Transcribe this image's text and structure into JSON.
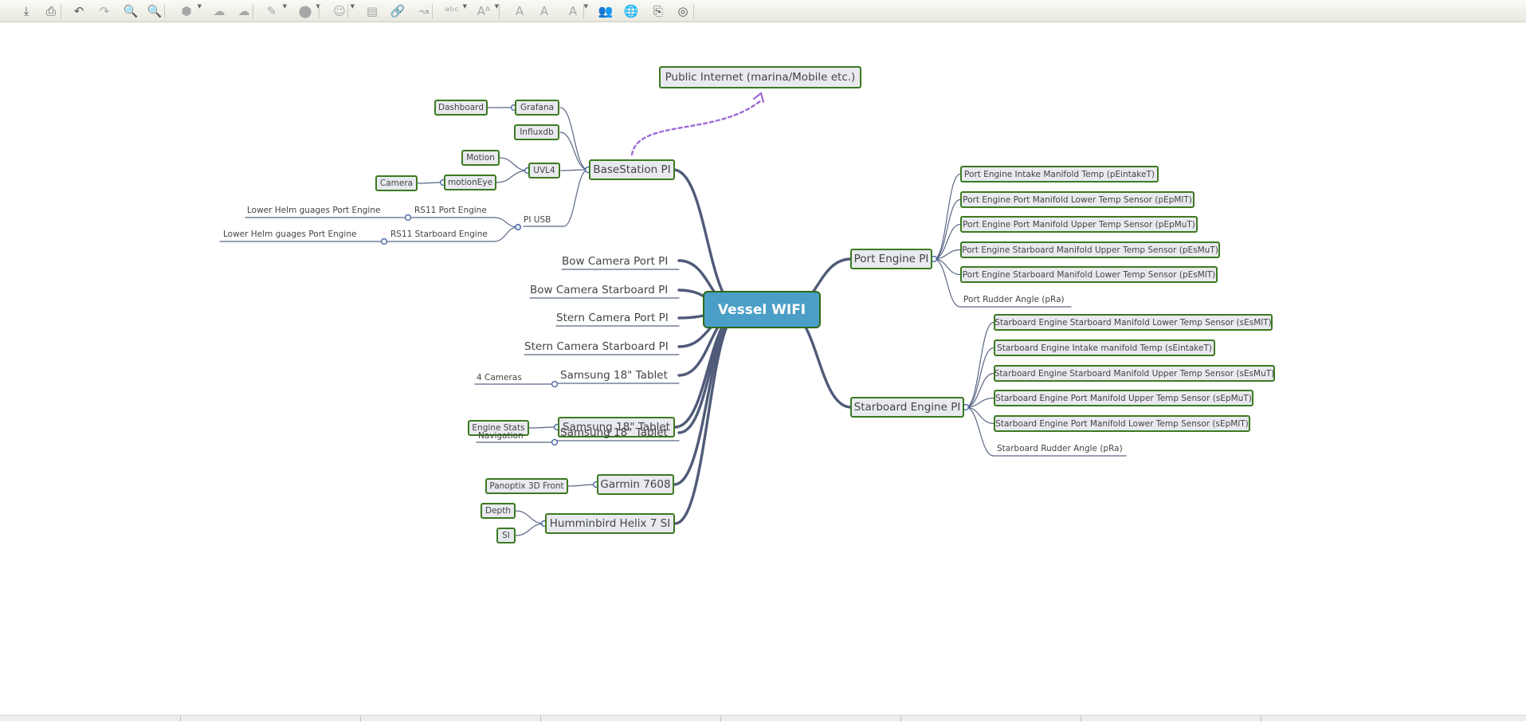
{
  "toolbar": {
    "buttons": [
      {
        "id": "save-icon",
        "glyph": "⤓",
        "dim": false,
        "drop": false
      },
      {
        "id": "print-icon",
        "glyph": "⎙",
        "dim": false,
        "drop": false
      },
      {
        "id": "undo-icon",
        "glyph": "↶",
        "dim": false,
        "drop": false
      },
      {
        "id": "redo-icon",
        "glyph": "↷",
        "dim": true,
        "drop": false
      },
      {
        "id": "zoom-out-icon",
        "glyph": "🔍",
        "dim": false,
        "drop": false
      },
      {
        "id": "zoom-in-icon",
        "glyph": "🔍",
        "dim": false,
        "drop": false
      },
      {
        "id": "topic-shape-icon",
        "glyph": "⬢",
        "dim": true,
        "drop": true
      },
      {
        "id": "add-topic-icon",
        "glyph": "☁",
        "dim": true,
        "drop": false
      },
      {
        "id": "delete-topic-icon",
        "glyph": "☁",
        "dim": true,
        "drop": false
      },
      {
        "id": "border-color-icon",
        "glyph": "✎",
        "dim": true,
        "drop": true
      },
      {
        "id": "fill-color-icon",
        "glyph": "⬤",
        "dim": true,
        "drop": true
      },
      {
        "id": "icon-picker-icon",
        "glyph": "☺",
        "dim": true,
        "drop": true
      },
      {
        "id": "note-icon",
        "glyph": "▤",
        "dim": true,
        "drop": false
      },
      {
        "id": "link-icon",
        "glyph": "🔗",
        "dim": true,
        "drop": false
      },
      {
        "id": "relationship-icon",
        "glyph": "↝",
        "dim": true,
        "drop": false
      },
      {
        "id": "font-family-icon",
        "glyph": "ᵃᵇᶜ",
        "dim": true,
        "drop": true
      },
      {
        "id": "font-size-icon",
        "glyph": "Aᴬ",
        "dim": true,
        "drop": true
      },
      {
        "id": "bold-icon",
        "glyph": "A",
        "dim": true,
        "drop": false
      },
      {
        "id": "italic-icon",
        "glyph": "A",
        "dim": true,
        "drop": false
      },
      {
        "id": "font-color-icon",
        "glyph": "A",
        "dim": true,
        "drop": true
      },
      {
        "id": "share-icon",
        "glyph": "👥",
        "dim": false,
        "drop": false
      },
      {
        "id": "publish-icon",
        "glyph": "🌐",
        "dim": false,
        "drop": false
      },
      {
        "id": "export-icon",
        "glyph": "⎘",
        "dim": false,
        "drop": false
      },
      {
        "id": "history-icon",
        "glyph": "◎",
        "dim": false,
        "drop": false
      }
    ]
  },
  "colors": {
    "trunk": "#4f5b78",
    "branch": "#5a6784",
    "leaf_border": "#3c7a1f",
    "leaf_fill": "#e8eaf0",
    "root_fill": "#4b9fc7",
    "relationship": "#a06ad8",
    "connector_dot": "#4a67a8"
  },
  "mindmap": {
    "root": "Vessel WIFI",
    "public_internet": "Public Internet (marina/Mobile etc.)",
    "basestation": {
      "label": "BaseStation PI",
      "grafana": "Grafana",
      "dashboard": "Dashboard",
      "influxdb": "Influxdb",
      "uvl4": "UVL4",
      "motion": "Motion",
      "motioneye": "motionEye",
      "camera": "Camera",
      "pi_usb": "PI USB",
      "rs11_port": "RS11 Port Engine",
      "rs11_port_child": "Lower Helm guages Port Engine",
      "rs11_stbd": "RS11 Starboard Engine",
      "rs11_stbd_child": "Lower Helm guages Port Engine"
    },
    "bow_cam_port": "Bow Camera Port PI",
    "bow_cam_stbd": "Bow Camera Starboard PI",
    "stern_cam_port": "Stern Camera Port PI",
    "stern_cam_stbd": "Stern Camera Starboard PI",
    "tablet1": {
      "label": "Samsung 18\" Tablet",
      "child": "4 Cameras"
    },
    "tablet2": {
      "label": "Samsung 18\" Tablet",
      "child": "Engine Stats"
    },
    "tablet3": {
      "label": "Samsung 18\" Tablet",
      "child": "Navigation"
    },
    "garmin": {
      "label": "Garmin 7608",
      "child": "Panoptix 3D Front"
    },
    "humminbird": {
      "label": "Humminbird Helix 7 SI",
      "depth": "Depth",
      "si": "SI"
    },
    "port_engine": {
      "label": "Port Engine PI",
      "sensors": [
        "Port Engine Intake Manifold Temp (pEintakeT)",
        "Port Engine Port Manifold Lower Temp Sensor (pEpMlT)",
        "Port Engine Port Manifold Upper Temp Sensor (pEpMuT)",
        "Port Engine Starboard Manifold Upper Temp Sensor (pEsMuT)",
        "Port Engine Starboard Manifold Lower Temp Sensor (pEsMlT)"
      ],
      "rudder": "Port Rudder Angle (pRa)"
    },
    "starboard_engine": {
      "label": "Starboard Engine PI",
      "sensors": [
        "Starboard Engine Starboard Manifold Lower Temp Sensor (sEsMlT)",
        "Starboard Engine Intake manifold Temp (sEintakeT)",
        "Starboard Engine Starboard Manifold Upper Temp Sensor (sEsMuT)",
        "Starboard Engine Port Manifold Upper Temp Sensor (sEpMuT)",
        "Starboard Engine Port Manifold Lower Temp Sensor (sEpMlT)"
      ],
      "rudder": "Starboard Rudder Angle (pRa)"
    }
  }
}
